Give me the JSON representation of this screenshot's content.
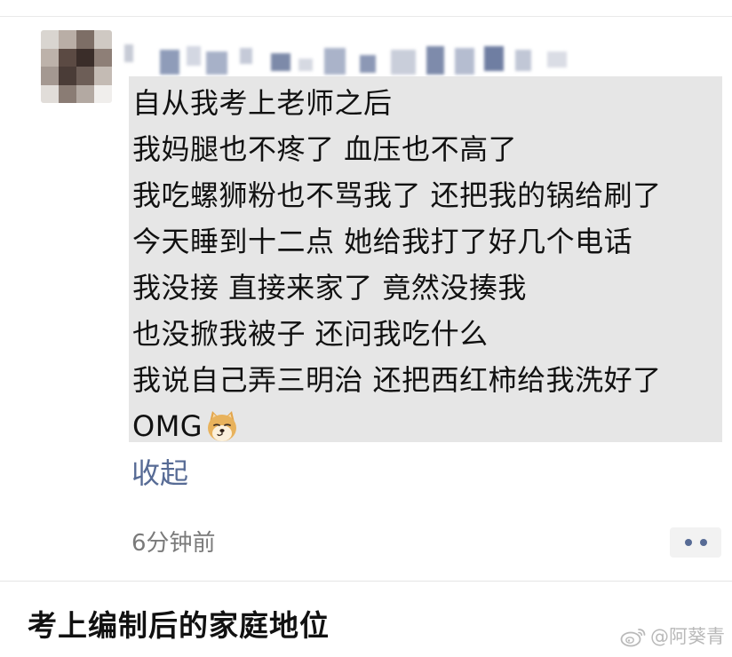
{
  "post": {
    "lines": [
      "自从我考上老师之后",
      "我妈腿也不疼了 血压也不高了",
      "我吃螺狮粉也不骂我了 还把我的锅给刷了",
      "今天睡到十二点 她给我打了好几个电话",
      "我没接 直接来家了 竟然没揍我",
      "也没掀我被子 还问我吃什么",
      "我说自己弄三明治 还把西红柿给我洗好了",
      "OMG"
    ],
    "emoji": "doge-icon",
    "collapse_label": "收起",
    "timestamp": "6分钟前"
  },
  "caption": "考上编制后的家庭地位",
  "watermark": {
    "text": "@阿葵青",
    "icon": "weibo-icon"
  },
  "colors": {
    "link": "#576b95",
    "highlight": "#e6e6e6",
    "timestamp": "#7a7a7a",
    "watermark": "#b9b9b9"
  }
}
